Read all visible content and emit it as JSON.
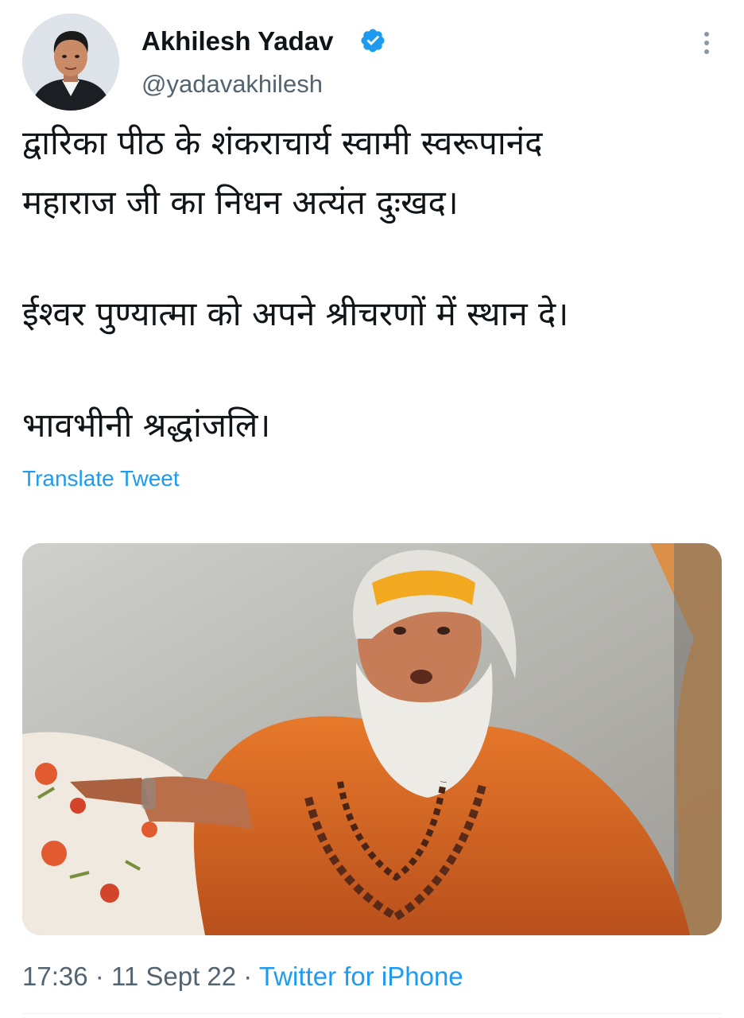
{
  "author": {
    "display_name": "Akhilesh Yadav",
    "handle": "@yadavakhilesh",
    "verified": true,
    "avatar_icon": "profile-photo",
    "verified_icon": "verified-badge-icon",
    "more_icon": "more-options-icon"
  },
  "tweet": {
    "lines": [
      "द्वारिका पीठ के शंकराचार्य स्वामी स्वरूपानंद",
      "महाराज जी का निधन अत्यंत दुःखद।",
      "ईश्वर पुण्यात्मा को अपने श्रीचरणों में स्थान दे।",
      "भावभीनी श्रद्धांजलि।"
    ],
    "translate_label": "Translate Tweet"
  },
  "media": {
    "icon": "tweet-photo"
  },
  "meta": {
    "time": "17:36",
    "date": "11 Sept 22",
    "separator": "·",
    "source": "Twitter for iPhone"
  },
  "colors": {
    "link_blue": "#1d9bf0",
    "text_primary": "#0f1419",
    "text_secondary": "#536471",
    "divider": "#eff3f4"
  }
}
